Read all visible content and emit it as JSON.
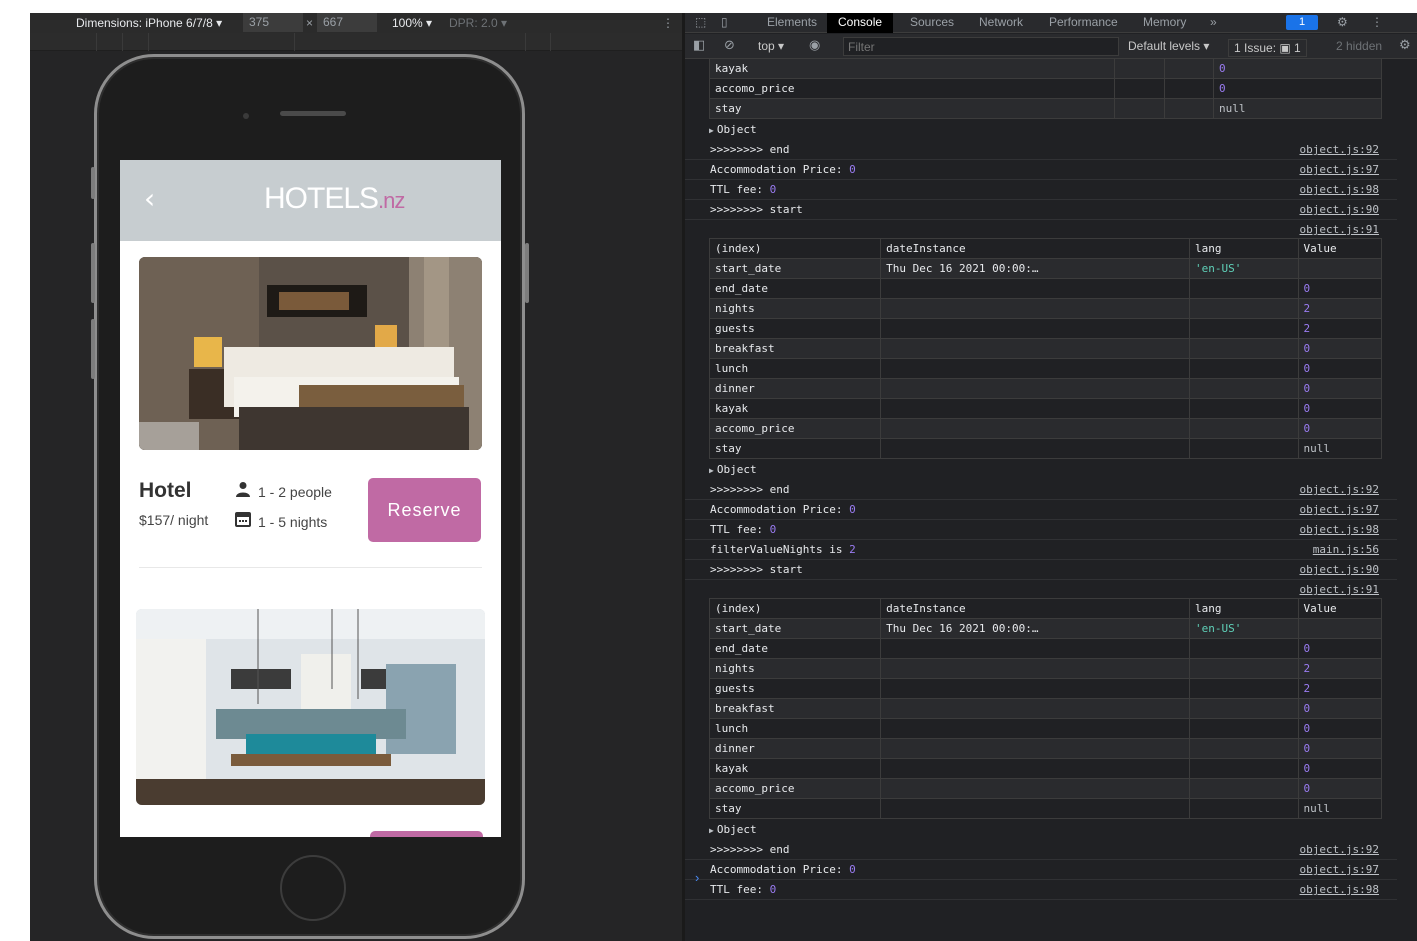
{
  "device_toolbar": {
    "dimensions_label": "Dimensions: iPhone 6/7/8 ▾",
    "width": "375",
    "x_symbol": "×",
    "height": "667",
    "zoom": "100% ▾",
    "dpr": "DPR: 2.0 ▾",
    "more_icon": "⋮"
  },
  "app": {
    "back_icon": "‹",
    "logo_main": "HOTELS",
    "logo_suffix": ".nz",
    "accent_color": "#c06aa4",
    "card": {
      "title": "Hotel",
      "price": "$157/ night",
      "people": "1 - 2 people",
      "nights": "1 - 5 nights",
      "reserve_label": "Reserve"
    }
  },
  "devtools": {
    "tabs": [
      "Elements",
      "Console",
      "Sources",
      "Network",
      "Performance",
      "Memory"
    ],
    "more_tabs": "»",
    "issue_badge": "1",
    "toolbar": {
      "context": "top ▾",
      "filter_placeholder": "Filter",
      "levels": "Default levels ▾",
      "issues": "1 Issue: ▣ 1",
      "hidden": "2 hidden"
    }
  },
  "console": {
    "table_headers": [
      "(index)",
      "dateInstance",
      "lang",
      "Value"
    ],
    "top_fragment": [
      {
        "k": "kayak",
        "v": "0",
        "t": "n"
      },
      {
        "k": "accomo_price",
        "v": "0",
        "t": "n"
      },
      {
        "k": "stay",
        "v": "null",
        "t": "z"
      }
    ],
    "table_rows": [
      {
        "k": "start_date",
        "date": "Thu Dec 16 2021 00:00:…",
        "lang": "'en-US'",
        "v": "",
        "t": ""
      },
      {
        "k": "end_date",
        "v": "0",
        "t": "n"
      },
      {
        "k": "nights",
        "v": "2",
        "t": "n"
      },
      {
        "k": "guests",
        "v": "2",
        "t": "n"
      },
      {
        "k": "breakfast",
        "v": "0",
        "t": "n"
      },
      {
        "k": "lunch",
        "v": "0",
        "t": "n"
      },
      {
        "k": "dinner",
        "v": "0",
        "t": "n"
      },
      {
        "k": "kayak",
        "v": "0",
        "t": "n"
      },
      {
        "k": "accomo_price",
        "v": "0",
        "t": "n"
      },
      {
        "k": "stay",
        "v": "null",
        "t": "z"
      }
    ],
    "object_label": "Object",
    "logs_a": [
      {
        "text": ">>>>>>>> end",
        "link": "object.js:92"
      },
      {
        "text": "Accommodation Price:",
        "num": "0",
        "link": "object.js:97"
      },
      {
        "text": "TTL fee:",
        "num": "0",
        "link": "object.js:98"
      },
      {
        "text": ">>>>>>>> start",
        "link": "object.js:90"
      }
    ],
    "link_91": "object.js:91",
    "logs_b": [
      {
        "text": ">>>>>>>> end",
        "link": "object.js:92"
      },
      {
        "text": "Accommodation Price:",
        "num": "0",
        "link": "object.js:97"
      },
      {
        "text": "TTL fee:",
        "num": "0",
        "link": "object.js:98"
      },
      {
        "text": "filterValueNights is",
        "num": "2",
        "link": "main.js:56"
      },
      {
        "text": ">>>>>>>> start",
        "link": "object.js:90"
      }
    ],
    "logs_c": [
      {
        "text": ">>>>>>>> end",
        "link": "object.js:92"
      },
      {
        "text": "Accommodation Price:",
        "num": "0",
        "link": "object.js:97"
      },
      {
        "text": "TTL fee:",
        "num": "0",
        "link": "object.js:98"
      }
    ],
    "prompt": "›"
  }
}
